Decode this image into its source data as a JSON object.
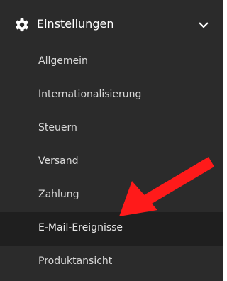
{
  "menu": {
    "title": "Einstellungen",
    "header_icon": "gear-icon",
    "toggle_icon": "chevron-down-icon",
    "items": [
      {
        "label": "Allgemein",
        "active": false
      },
      {
        "label": "Internationalisierung",
        "active": false
      },
      {
        "label": "Steuern",
        "active": false
      },
      {
        "label": "Versand",
        "active": false
      },
      {
        "label": "Zahlung",
        "active": false
      },
      {
        "label": "E-Mail-Ereignisse",
        "active": true
      },
      {
        "label": "Produktansicht",
        "active": false
      }
    ]
  },
  "annotation": {
    "icon": "red-arrow-icon",
    "color": "#ff1a1a",
    "points_to": "E-Mail-Ereignisse"
  },
  "colors": {
    "background": "#2b2b2b",
    "active_background": "#1f1f1f",
    "text": "#d9d9d9",
    "title": "#ffffff"
  }
}
